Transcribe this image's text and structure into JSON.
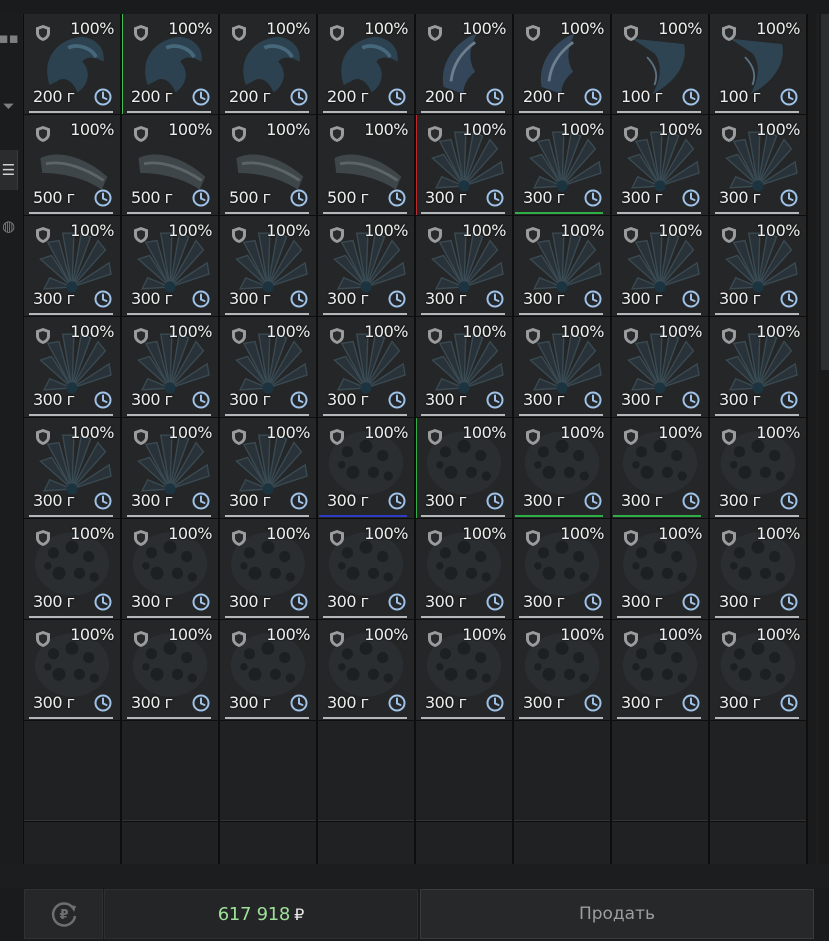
{
  "inventory": {
    "rows": [
      [
        {
          "cond": "100%",
          "weight": "200 г",
          "kind": "fang"
        },
        {
          "cond": "100%",
          "weight": "200 г",
          "kind": "fang",
          "accent": "#3fbf57",
          "accent_side": "left"
        },
        {
          "cond": "100%",
          "weight": "200 г",
          "kind": "fang"
        },
        {
          "cond": "100%",
          "weight": "200 г",
          "kind": "fang"
        },
        {
          "cond": "100%",
          "weight": "200 г",
          "kind": "claw"
        },
        {
          "cond": "100%",
          "weight": "200 г",
          "kind": "claw"
        },
        {
          "cond": "100%",
          "weight": "100 г",
          "kind": "horn"
        },
        {
          "cond": "100%",
          "weight": "100 г",
          "kind": "horn"
        }
      ],
      [
        {
          "cond": "100%",
          "weight": "500 г",
          "kind": "bone"
        },
        {
          "cond": "100%",
          "weight": "500 г",
          "kind": "bone"
        },
        {
          "cond": "100%",
          "weight": "500 г",
          "kind": "bone"
        },
        {
          "cond": "100%",
          "weight": "500 г",
          "kind": "bone"
        },
        {
          "cond": "100%",
          "weight": "300 г",
          "kind": "leaf",
          "accent": "#c0282b",
          "accent_side": "left"
        },
        {
          "cond": "100%",
          "weight": "300 г",
          "kind": "leaf",
          "accent": "#2fae48",
          "accent_side": "bottom"
        },
        {
          "cond": "100%",
          "weight": "300 г",
          "kind": "leaf"
        },
        {
          "cond": "100%",
          "weight": "300 г",
          "kind": "leaf"
        }
      ],
      [
        {
          "cond": "100%",
          "weight": "300 г",
          "kind": "leaf"
        },
        {
          "cond": "100%",
          "weight": "300 г",
          "kind": "leaf"
        },
        {
          "cond": "100%",
          "weight": "300 г",
          "kind": "leaf"
        },
        {
          "cond": "100%",
          "weight": "300 г",
          "kind": "leaf"
        },
        {
          "cond": "100%",
          "weight": "300 г",
          "kind": "leaf"
        },
        {
          "cond": "100%",
          "weight": "300 г",
          "kind": "leaf"
        },
        {
          "cond": "100%",
          "weight": "300 г",
          "kind": "leaf"
        },
        {
          "cond": "100%",
          "weight": "300 г",
          "kind": "leaf"
        }
      ],
      [
        {
          "cond": "100%",
          "weight": "300 г",
          "kind": "leaf"
        },
        {
          "cond": "100%",
          "weight": "300 г",
          "kind": "leaf"
        },
        {
          "cond": "100%",
          "weight": "300 г",
          "kind": "leaf"
        },
        {
          "cond": "100%",
          "weight": "300 г",
          "kind": "leaf"
        },
        {
          "cond": "100%",
          "weight": "300 г",
          "kind": "leaf"
        },
        {
          "cond": "100%",
          "weight": "300 г",
          "kind": "leaf"
        },
        {
          "cond": "100%",
          "weight": "300 г",
          "kind": "leaf"
        },
        {
          "cond": "100%",
          "weight": "300 г",
          "kind": "leaf"
        }
      ],
      [
        {
          "cond": "100%",
          "weight": "300 г",
          "kind": "leaf"
        },
        {
          "cond": "100%",
          "weight": "300 г",
          "kind": "leaf"
        },
        {
          "cond": "100%",
          "weight": "300 г",
          "kind": "leaf"
        },
        {
          "cond": "100%",
          "weight": "300 г",
          "kind": "rock",
          "accent": "#2f3cc0",
          "accent_side": "bottom"
        },
        {
          "cond": "100%",
          "weight": "300 г",
          "kind": "rock",
          "accent": "#2fae48",
          "accent_side": "left"
        },
        {
          "cond": "100%",
          "weight": "300 г",
          "kind": "rock",
          "accent": "#2fae48",
          "accent_side": "bottom"
        },
        {
          "cond": "100%",
          "weight": "300 г",
          "kind": "rock",
          "accent": "#2fae48",
          "accent_side": "bottom"
        },
        {
          "cond": "100%",
          "weight": "300 г",
          "kind": "rock"
        }
      ],
      [
        {
          "cond": "100%",
          "weight": "300 г",
          "kind": "rock"
        },
        {
          "cond": "100%",
          "weight": "300 г",
          "kind": "rock"
        },
        {
          "cond": "100%",
          "weight": "300 г",
          "kind": "rock"
        },
        {
          "cond": "100%",
          "weight": "300 г",
          "kind": "rock"
        },
        {
          "cond": "100%",
          "weight": "300 г",
          "kind": "rock"
        },
        {
          "cond": "100%",
          "weight": "300 г",
          "kind": "rock"
        },
        {
          "cond": "100%",
          "weight": "300 г",
          "kind": "rock"
        },
        {
          "cond": "100%",
          "weight": "300 г",
          "kind": "rock"
        }
      ],
      [
        {
          "cond": "100%",
          "weight": "300 г",
          "kind": "rock"
        },
        {
          "cond": "100%",
          "weight": "300 г",
          "kind": "rock"
        },
        {
          "cond": "100%",
          "weight": "300 г",
          "kind": "rock"
        },
        {
          "cond": "100%",
          "weight": "300 г",
          "kind": "rock"
        },
        {
          "cond": "100%",
          "weight": "300 г",
          "kind": "rock"
        },
        {
          "cond": "100%",
          "weight": "300 г",
          "kind": "rock"
        },
        {
          "cond": "100%",
          "weight": "300 г",
          "kind": "rock"
        },
        {
          "cond": "100%",
          "weight": "300 г",
          "kind": "rock"
        }
      ]
    ],
    "empty_cells": 16,
    "icons": {
      "slot_lock": "shield-icon",
      "timer": "clock-icon"
    },
    "colors": {
      "underline": "#b5b8ba",
      "clock": "#9fc2e8"
    }
  },
  "footer": {
    "balance": "617 918",
    "currency_symbol": "₽",
    "sell_label": "Продать",
    "refresh_icon": "ruble-refresh-icon"
  }
}
